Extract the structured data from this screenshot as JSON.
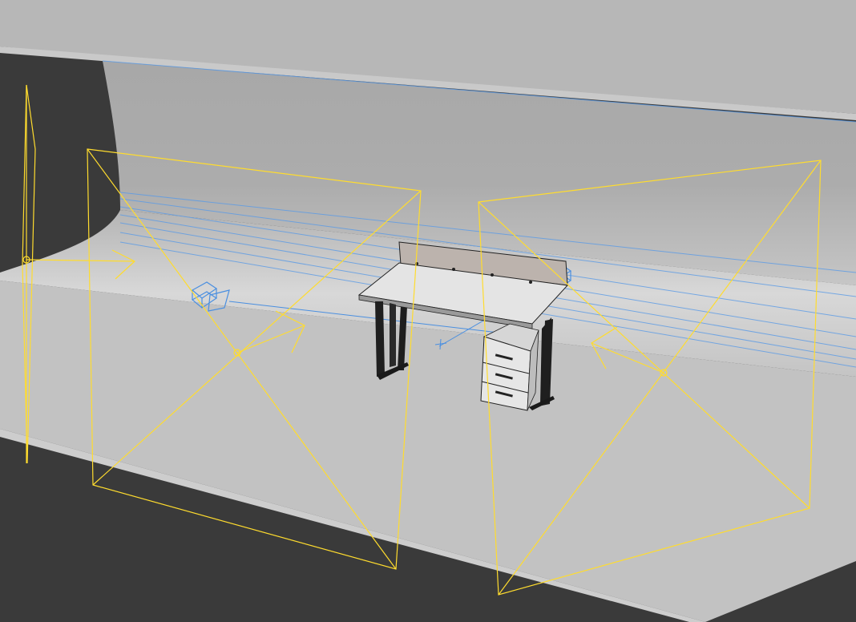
{
  "viewport": {
    "colors": {
      "background": "#3a3a3a",
      "cyclorama_top": "#b9b9b9",
      "cyclorama_wall": "#a6a6a6",
      "floor": "#c1c1c1",
      "cove_highlight": "#d6d6d6",
      "light_gizmo": "#ffdc2e",
      "helper_wire": "#4a8fe0",
      "desk_top": "#e3e3e3",
      "desk_frame": "#1e1e1e",
      "privacy_panel": "#bdb4ae",
      "drawer_unit": "#e6e6e6"
    },
    "icons": {
      "area_light": "area-light-icon",
      "directional_light": "directional-light-icon",
      "camera": "camera-icon",
      "target": "target-cross-icon"
    }
  }
}
